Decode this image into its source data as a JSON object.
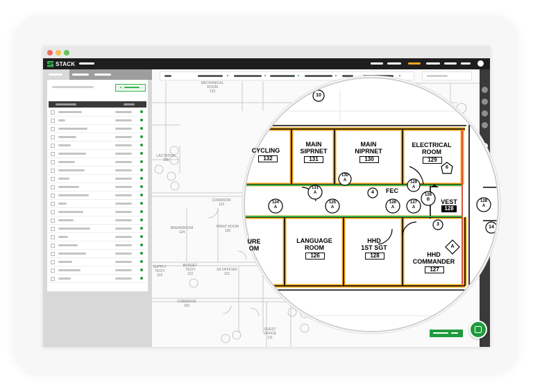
{
  "app": {
    "logo_text": "STACK",
    "colors": {
      "accent": "#35b44a",
      "dark": "#1e1e1e",
      "highlight": "#f2a81d"
    }
  },
  "window_controls": [
    {
      "name": "close",
      "color": "#ee6a5f"
    },
    {
      "name": "minimize",
      "color": "#f5be4f"
    },
    {
      "name": "maximize",
      "color": "#61c554"
    }
  ],
  "sidebar": {
    "row_count": 21
  },
  "plan_labels": {
    "mechanical": "MECHANICAL",
    "mechanical_room": "ROOM",
    "mechanical_num": "123",
    "lactation": "LACTATION",
    "lactation_num": "108",
    "corridor_1": "CORRIDOR",
    "corridor_1_num": "122",
    "breakroom": "BREAKROOM",
    "breakroom_num": "124",
    "print_room": "PRINT ROOM",
    "print_room_num": "120",
    "supply": "SUPPLY",
    "tech": "TECH",
    "supply_num": "119",
    "budget": "BUDGET",
    "budget_tech": "TECH",
    "budget_num": "122",
    "s4": "S4 OFFICER",
    "s4_num": "121",
    "corridor_2": "CORRIDOR",
    "corridor_2_num": "103",
    "guest": "GUEST",
    "guest_office": "OFFICE",
    "guest_num": "111"
  },
  "magnifier": {
    "rooms": {
      "cycling": "CYCLING",
      "cycling_num": "132",
      "main_siprnet_1": "MAIN",
      "main_siprnet_2": "SIPRNET",
      "main_siprnet_num": "131",
      "main_niprnet_1": "MAIN",
      "main_niprnet_2": "NIPRNET",
      "main_niprnet_num": "130",
      "electrical_1": "ELECTRICAL",
      "electrical_2": "ROOM",
      "electrical_num": "129",
      "fec": "FEC",
      "vest": "VEST",
      "vest_num": "128",
      "ure": "URE",
      "om": "OM",
      "language_1": "LANGUAGE",
      "language_2": "ROOM",
      "language_num": "126",
      "hhd_1": "HHD",
      "hhd_2": "1ST SGT",
      "hhd_num": "128",
      "hhd_cmd_1": "HHD",
      "hhd_cmd_2": "COMMANDER",
      "hhd_cmd_num": "127"
    },
    "tags": {
      "t10": "10",
      "t131_1": "131",
      "t131_2": "A",
      "t130_1": "130",
      "t130_2": "A",
      "t4": "4",
      "t6": "6",
      "t129_1": "129",
      "t129_2": "A",
      "t124_1": "124",
      "t124_2": "A",
      "t125_1": "125",
      "t125_2": "A",
      "t126_1": "126",
      "t126_2": "A",
      "t127_1": "127",
      "t127_2": "A",
      "t128_1": "128",
      "t128_2": "B",
      "t3": "3",
      "tA": "A",
      "t14": "14",
      "t128b_1": "128",
      "t128b_2": "A"
    }
  }
}
